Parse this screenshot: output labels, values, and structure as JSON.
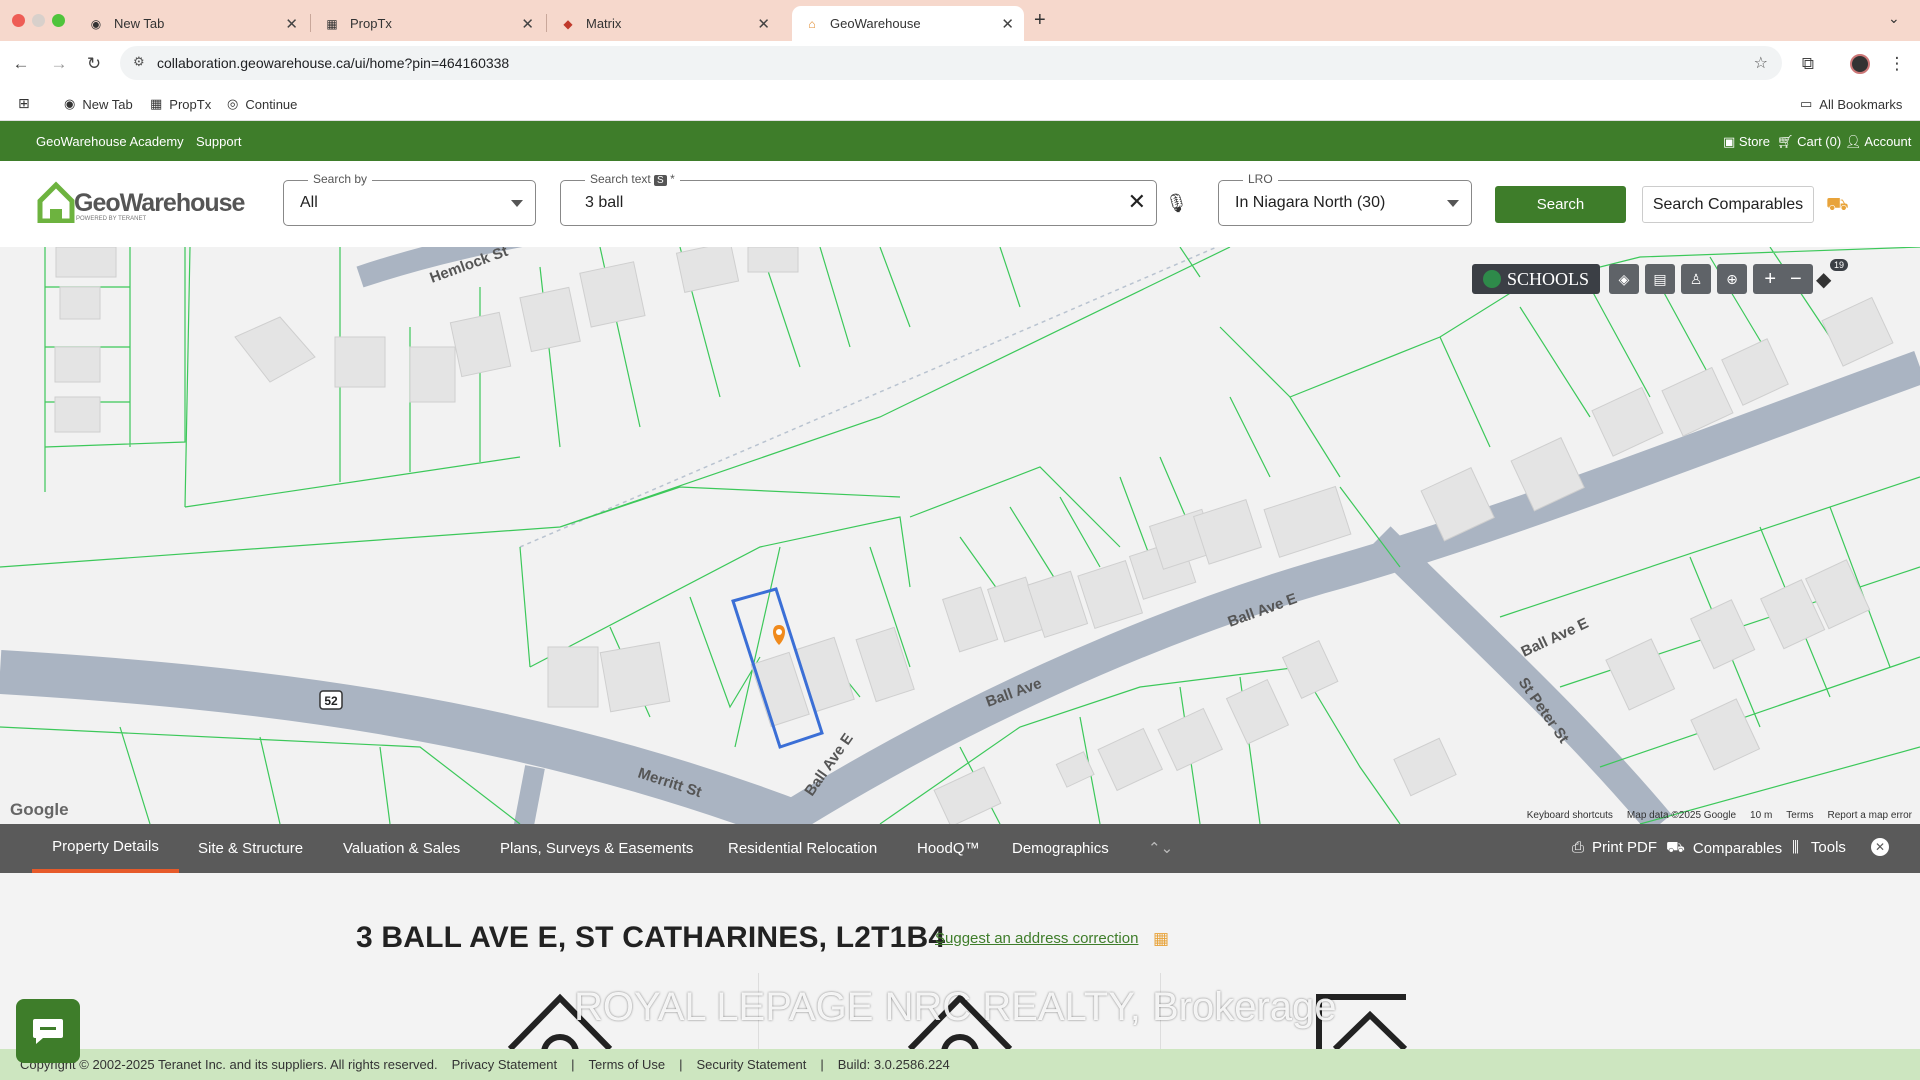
{
  "browser": {
    "tabs": [
      {
        "title": "New Tab",
        "active": false
      },
      {
        "title": "PropTx",
        "active": false
      },
      {
        "title": "Matrix",
        "active": false
      },
      {
        "title": "GeoWarehouse",
        "active": true
      }
    ],
    "url": "collaboration.geowarehouse.ca/ui/home?pin=464160338",
    "bookmarks": [
      "New Tab",
      "PropTx",
      "Continue"
    ],
    "all_bookmarks": "All Bookmarks"
  },
  "greenbar": {
    "left": [
      "GeoWarehouse Academy",
      "Support"
    ],
    "store": "Store",
    "cart": "Cart (0)",
    "account": "Account"
  },
  "header": {
    "logo_main": "GeoWarehouse",
    "logo_sub": "POWERED BY TERANET",
    "search_by_label": "Search by",
    "search_by_value": "All",
    "search_text_label": "Search text",
    "search_text_badge": "S",
    "search_text_required": "*",
    "search_text_value": "3 ball",
    "lro_label": "LRO",
    "lro_value": "In Niagara North (30)",
    "search_button": "Search",
    "comparables_button": "Search Comparables"
  },
  "map": {
    "schools_label": "SCHOOLS",
    "layers_badge": "19",
    "streets": [
      "Hemlock St",
      "Ball Ave E",
      "Ball Ave",
      "Ball Ave E",
      "Ball Ave E",
      "St Peter St",
      "Merritt St",
      "52"
    ],
    "google": "Google",
    "footer": [
      "Keyboard shortcuts",
      "Map data ©2025 Google",
      "10 m",
      "Terms",
      "Report a map error"
    ]
  },
  "property_tabs": [
    "Property Details",
    "Site & Structure",
    "Valuation & Sales",
    "Plans, Surveys & Easements",
    "Residential Relocation",
    "HoodQ™",
    "Demographics"
  ],
  "tools": {
    "print": "Print PDF",
    "comparables": "Comparables",
    "tools": "Tools"
  },
  "content": {
    "address": "3 BALL AVE E, ST CATHARINES, L2T1B4",
    "suggest": "Suggest an address correction",
    "watermark": "ROYAL LEPAGE NRC REALTY, Brokerage"
  },
  "footer": {
    "copyright": "Copyright © 2002-2025 Teranet Inc. and its suppliers. All rights reserved.",
    "links": [
      "Privacy Statement",
      "Terms of Use",
      "Security Statement"
    ],
    "build": "Build: 3.0.2586.224"
  },
  "colors": {
    "brand_green": "#3e7d2a",
    "parcel_line": "#3cc85a",
    "road": "#aab4c2",
    "selected_parcel": "#3b6fd6",
    "marker": "#f08a1c"
  }
}
